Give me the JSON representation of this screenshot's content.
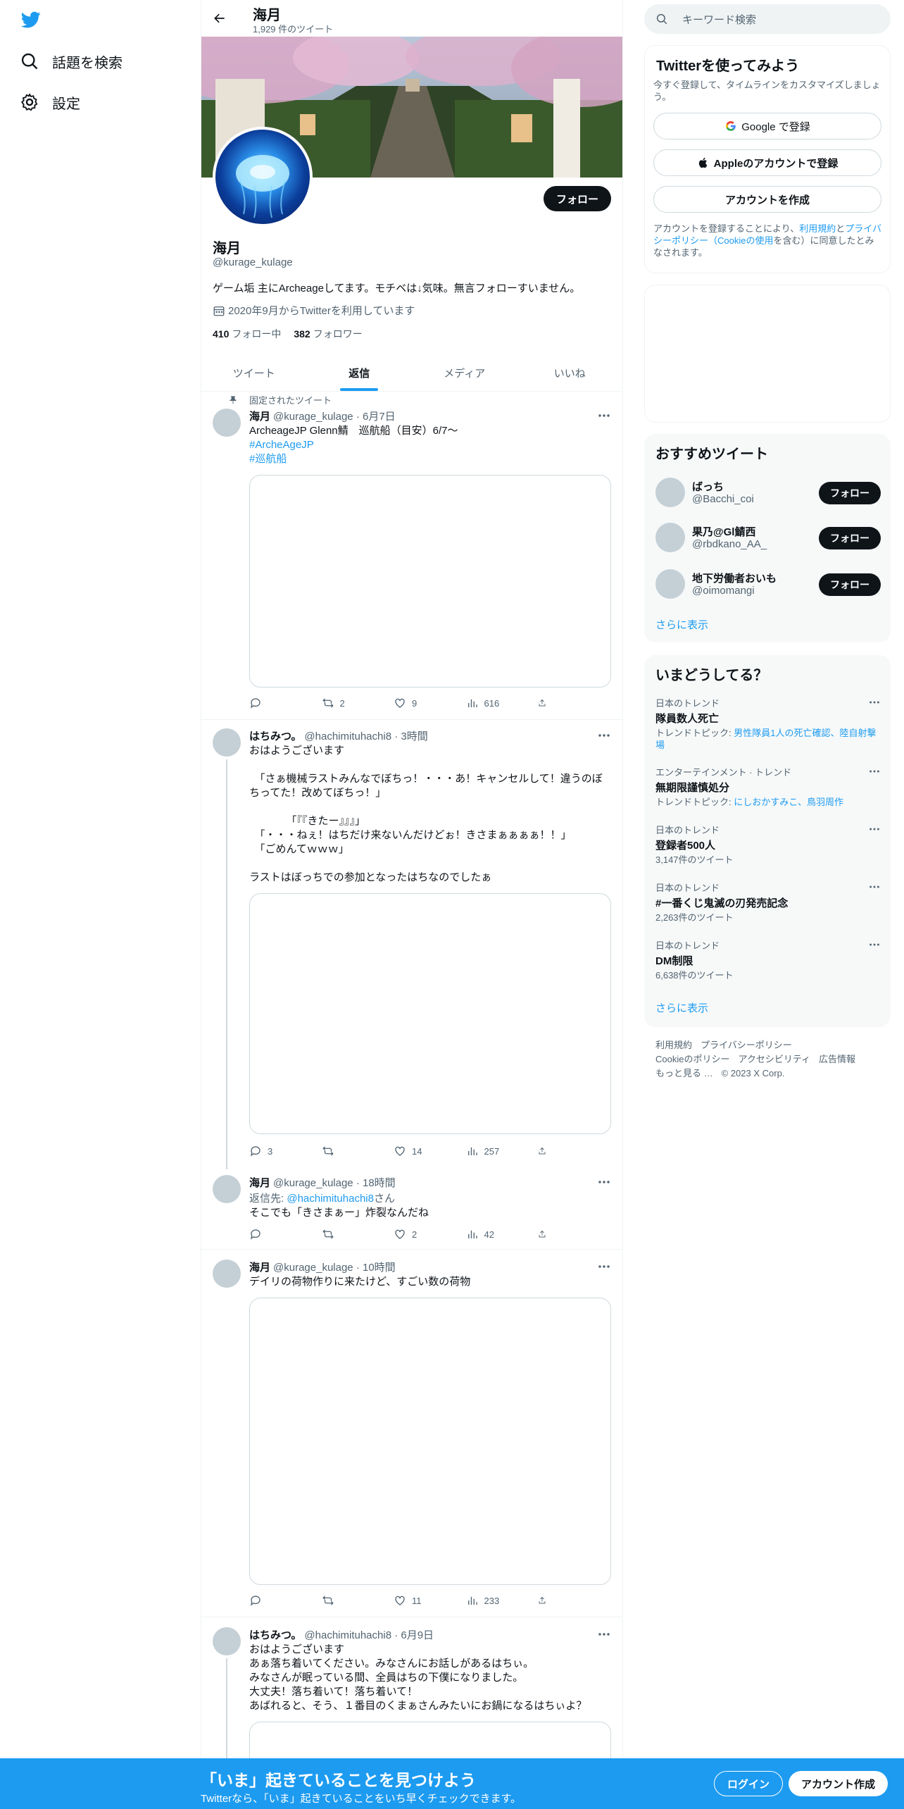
{
  "nav": {
    "explore_label": "話題を検索",
    "settings_label": "設定"
  },
  "header": {
    "name": "海月",
    "tweet_count": "1,929 件のツイート"
  },
  "profile": {
    "name": "海月",
    "handle": "@kurage_kulage",
    "bio": "ゲーム垢 主にArcheageしてます。モチベは↓気味。無言フォローすいません。",
    "joined": "2020年9月からTwitterを利用しています",
    "following_count": "410",
    "following_label": "フォロー中",
    "followers_count": "382",
    "followers_label": "フォロワー",
    "follow_button": "フォロー"
  },
  "tabs": [
    "ツイート",
    "返信",
    "メディア",
    "いいね"
  ],
  "pinned_label": "固定されたツイート",
  "tweets": [
    {
      "name": "海月",
      "meta": "@kurage_kulage · 6月7日",
      "line1": "ArcheageJP Glenn鯖　巡航船（目安）6/7～",
      "tag1": "#ArcheAgeJP",
      "tag2": "#巡航船",
      "reply_count": "",
      "retweet_count": "2",
      "like_count": "9",
      "view_count": "616"
    },
    {
      "name": "はちみつ。",
      "meta": "@hachimituhachi8 · 3時間",
      "text": "おはようございます\n\n　「さぁ機械ラストみんなでぼちっ！・・・あ！キャンセルして！違うのぼちってた！改めてぼちっ！」\n\n　　　　「『『きたー』』』」\n　「・・・ねぇ！はちだけ来ないんだけどぉ！きさまぁぁぁぁ！！」\n　「ごめんてｗｗｗ」\n\nラストはぼっちでの参加となったはちなのでしたぁ",
      "reply_count": "3",
      "retweet_count": "",
      "like_count": "14",
      "view_count": "257"
    },
    {
      "name": "海月",
      "meta": "@kurage_kulage · 18時間",
      "reply_prefix": "返信先: ",
      "reply_target": "@hachimituhachi8",
      "reply_suffix": "さん",
      "text": "そこでも「きさまぁー」炸裂なんだね",
      "reply_count": "",
      "retweet_count": "",
      "like_count": "2",
      "view_count": "42"
    },
    {
      "name": "海月",
      "meta": "@kurage_kulage · 10時間",
      "text": "デイリの荷物作りに来たけど、すごい数の荷物",
      "reply_count": "",
      "retweet_count": "",
      "like_count": "11",
      "view_count": "233"
    },
    {
      "name": "はちみつ。",
      "meta": "@hachimituhachi8 · 6月9日",
      "text": "おはようございます\nあぁ落ち着いてください。みなさんにお話しがあるはちぃ。\nみなさんが眠っている間、全員はちの下僕になりました。\n大丈夫！落ち着いて！落ち着いて！\nあばれると、そう、１番目のくまぁさんみたいにお鍋になるはちぃよ？"
    }
  ],
  "right": {
    "search_placeholder": "キーワード検索",
    "signup_title": "Twitterを使ってみよう",
    "signup_sub": "今すぐ登録して、タイムラインをカスタマイズしましょう。",
    "google_btn": "Google で登録",
    "apple_btn": "Appleのアカウントで登録",
    "create_btn": "アカウントを作成",
    "legal_1": "アカウントを登録することにより、",
    "legal_terms": "利用規約",
    "legal_2": "と",
    "legal_privacy": "プライバシーポリシー（Cookieの使用",
    "legal_3": "を含む）に同意したとみなされます。",
    "rec_title": "おすすめツイート",
    "rec_users": [
      {
        "name": "ばっち",
        "handle": "@Bacchi_coi",
        "button": "フォロー"
      },
      {
        "name": "果乃@Gl鯖西",
        "handle": "@rbdkano_AA_",
        "button": "フォロー"
      },
      {
        "name": "地下労働者おいも",
        "handle": "@oimomangi",
        "button": "フォロー"
      }
    ],
    "show_more": "さらに表示",
    "trends_title": "いまどうしてる？",
    "trends": [
      {
        "context": "日本のトレンド",
        "title": "隊員数人死亡",
        "extra_prefix": "トレンドトピック: ",
        "extra_link": "男性隊員1人の死亡確認、陸自射撃場"
      },
      {
        "context": "エンターテインメント · トレンド",
        "title": "無期限謹慎処分",
        "extra_prefix": "トレンドトピック: ",
        "extra_link": "にしおかすみこ、鳥羽周作"
      },
      {
        "context": "日本のトレンド",
        "title": "登録者500人",
        "extra": "3,147件のツイート"
      },
      {
        "context": "日本のトレンド",
        "title": "#一番くじ鬼滅の刃発売記念",
        "extra": "2,263件のツイート"
      },
      {
        "context": "日本のトレンド",
        "title": "DM制限",
        "extra": "6,638件のツイート"
      }
    ],
    "trends_more": "さらに表示",
    "footer": {
      "terms": "利用規約",
      "privacy": "プライバシーポリシー",
      "cookie": "Cookieのポリシー",
      "accessibility": "アクセシビリティ",
      "ads": "広告情報",
      "more": "もっと見る …",
      "copyright": "© 2023 X Corp."
    }
  },
  "bottom": {
    "title": "「いま」起きていることを見つけよう",
    "sub": "Twitterなら、「いま」起きていることをいち早くチェックできます。",
    "login": "ログイン",
    "signup": "アカウント作成"
  },
  "colors": {
    "accent": "#1d9bf0",
    "text": "#0f1419",
    "muted": "#536471"
  }
}
